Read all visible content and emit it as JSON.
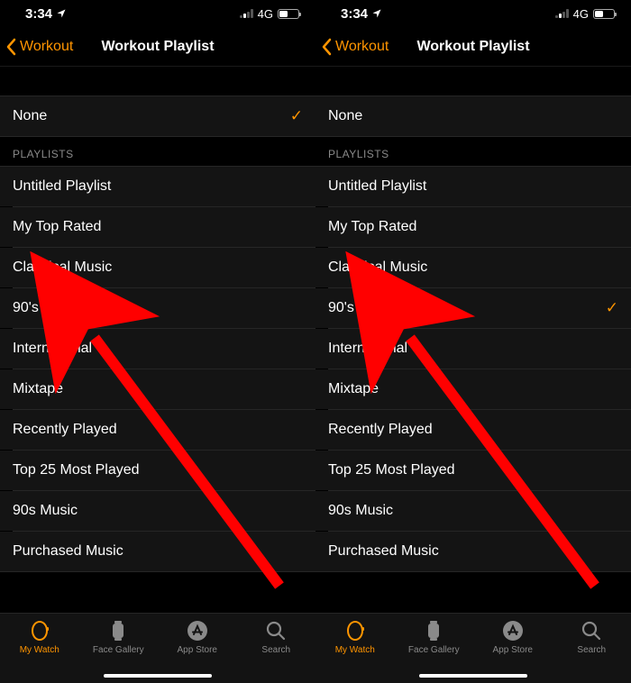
{
  "accent": "#ff9500",
  "status": {
    "time": "3:34",
    "network": "4G"
  },
  "nav": {
    "back_label": "Workout",
    "title": "Workout Playlist"
  },
  "none_row": {
    "label": "None"
  },
  "section_header": "PLAYLISTS",
  "playlists": [
    "Untitled Playlist",
    "My Top Rated",
    "Classical Music",
    "90's Music",
    "International",
    "Mixtape",
    "Recently Played",
    "Top 25 Most Played",
    "90s Music",
    "Purchased Music"
  ],
  "tabs": [
    {
      "label": "My Watch"
    },
    {
      "label": "Face Gallery"
    },
    {
      "label": "App Store"
    },
    {
      "label": "Search"
    }
  ],
  "screens": [
    {
      "none_checked": true,
      "selected_playlist_index": null
    },
    {
      "none_checked": false,
      "selected_playlist_index": 3
    }
  ]
}
